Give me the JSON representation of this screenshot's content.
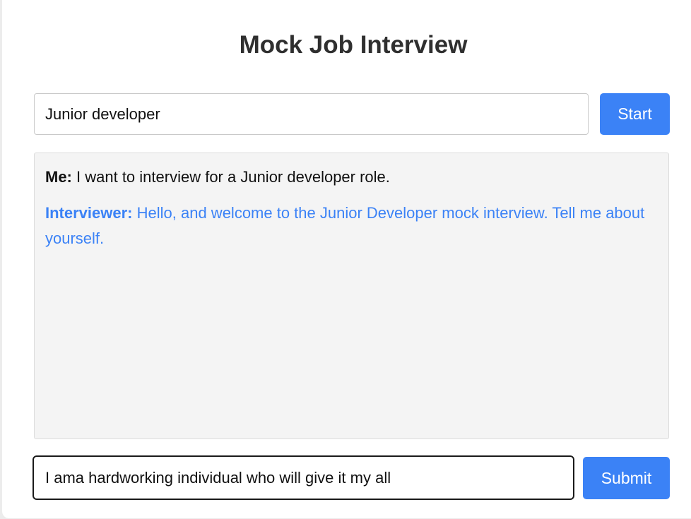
{
  "page": {
    "title": "Mock Job Interview"
  },
  "role_form": {
    "role_value": "Junior developer",
    "start_label": "Start"
  },
  "conversation": [
    {
      "speaker": "Me:",
      "text": "I want to interview for a Junior developer role."
    },
    {
      "speaker": "Interviewer:",
      "text": "Hello, and welcome to the Junior Developer mock interview. Tell me about yourself."
    }
  ],
  "answer_form": {
    "answer_value": "I ama hardworking individual who will give it my all",
    "submit_label": "Submit"
  },
  "colors": {
    "accent": "#3b82f6",
    "chat_background": "#f4f4f4",
    "title_text": "#2f2f2f"
  }
}
